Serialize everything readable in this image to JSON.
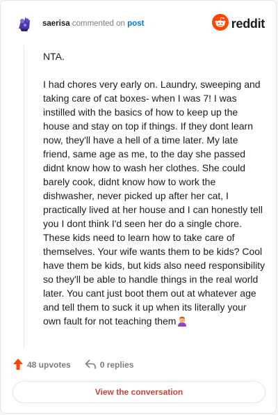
{
  "header": {
    "username": "saerisa",
    "commented_on": "commented on",
    "post_link": "post",
    "logo_text": "reddit"
  },
  "comment": {
    "paragraphs": [
      "NTA.",
      "I had chores very early on. Laundry, sweeping and taking care of cat boxes- when I was 7! I was instilled with the basics of how to keep up the house and stay on top if things. If they dont learn now, they'll have a hell of a time later. My late friend, same age as me, to the day she passed didnt know how to wash her clothes. She could barely cook, didnt know how to work the dishwasher, never picked up after her cat, I practically lived at her house and I can honestly tell you I dont think I'd seen her do a single chore. These kids need to learn how to take care of themselves. Your wife wants them to be kids? Cool have them be kids, but kids also need responsibility so they'll be able to handle things in the real world later. You cant just boot them out at whatever age and tell them to suck it up when its literally your own fault for not teaching them"
    ],
    "trailing_emoji": "person-facepalming-emoji"
  },
  "actions": {
    "upvotes": "48 upvotes",
    "replies": "0 replies"
  },
  "footer": {
    "view_conversation": "View the conversation"
  },
  "colors": {
    "reddit_orange": "#ff4500",
    "post_link_blue": "#0079d3",
    "button_text": "#c8463a",
    "muted_text": "#7c7c7c"
  }
}
